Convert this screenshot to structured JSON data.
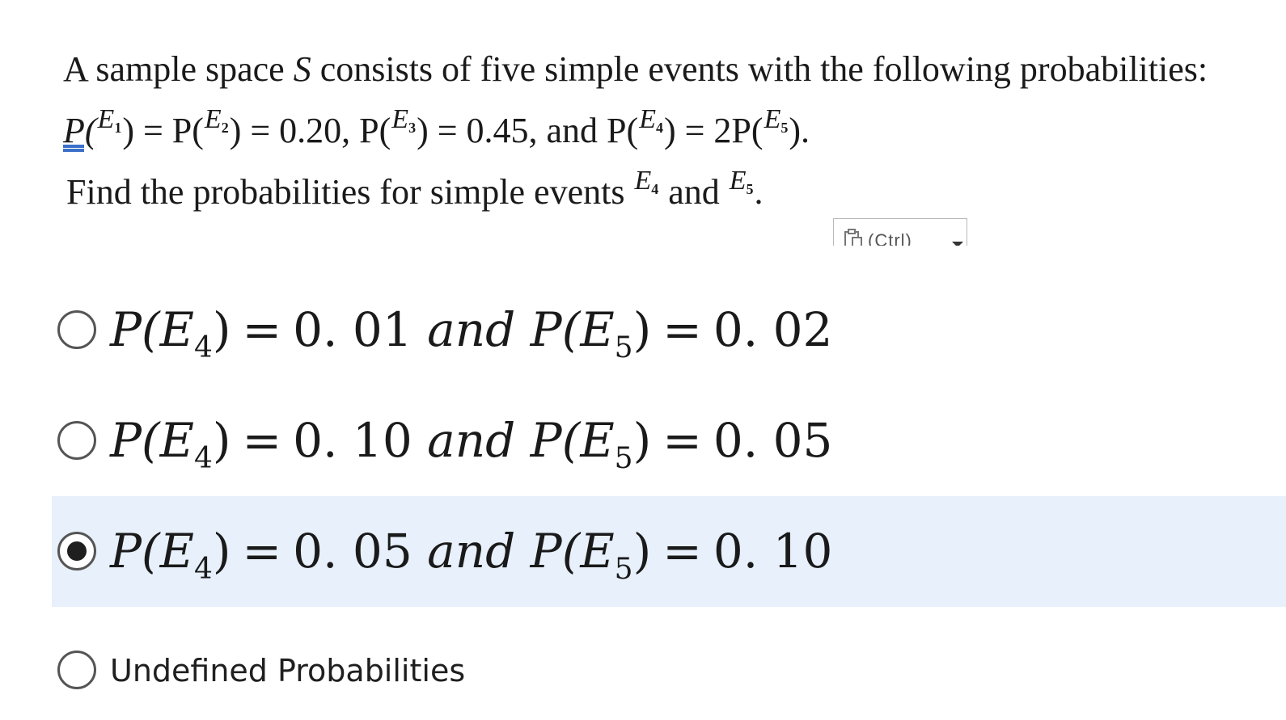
{
  "question": {
    "line1": "A sample space S consists of five simple events with the following probabilities:",
    "line1_parts": {
      "before": "A sample space ",
      "var": "S",
      "after": " consists of five simple events with the following probabilities:"
    },
    "line2": {
      "p": "P(",
      "e1": "E",
      "e1_sub": "1",
      "mid1": ") = P(",
      "e2": "E",
      "e2_sub": "2",
      "mid2": ") = 0.20, P(",
      "e3": "E",
      "e3_sub": "3",
      "mid3": ") = 0.45, and P(",
      "e4": "E",
      "e4_sub": "4",
      "mid4": ") = 2P(",
      "e5": "E",
      "e5_sub": "5",
      "end": ")."
    },
    "line3": {
      "before": "Find the probabilities for simple events ",
      "e4": "E",
      "e4_sub": "4",
      "mid": " and ",
      "e5": "E",
      "e5_sub": "5",
      "end": "."
    }
  },
  "paste_button": {
    "label": "(Ctrl)"
  },
  "options": [
    {
      "selected": false,
      "a_label": "P(E",
      "a_sub": "4",
      "a_close": ")",
      "eq1": "=",
      "a_val": "0. 01",
      "and": "and",
      "b_label": "P(E",
      "b_sub": "5",
      "b_close": ")",
      "eq2": "=",
      "b_val": "0. 02"
    },
    {
      "selected": false,
      "a_label": "P(E",
      "a_sub": "4",
      "a_close": ")",
      "eq1": "=",
      "a_val": "0. 10",
      "and": "and",
      "b_label": "P(E",
      "b_sub": "5",
      "b_close": ")",
      "eq2": "=",
      "b_val": "0. 05"
    },
    {
      "selected": true,
      "a_label": "P(E",
      "a_sub": "4",
      "a_close": ")",
      "eq1": "=",
      "a_val": "0. 05",
      "and": "and",
      "b_label": "P(E",
      "b_sub": "5",
      "b_close": ")",
      "eq2": "=",
      "b_val": "0. 10"
    },
    {
      "selected": false,
      "text": "Undefined Probabilities"
    }
  ],
  "colors": {
    "selected_bg": "#e7f0fb",
    "radio_border": "#555555",
    "text": "#1a1a1a"
  }
}
